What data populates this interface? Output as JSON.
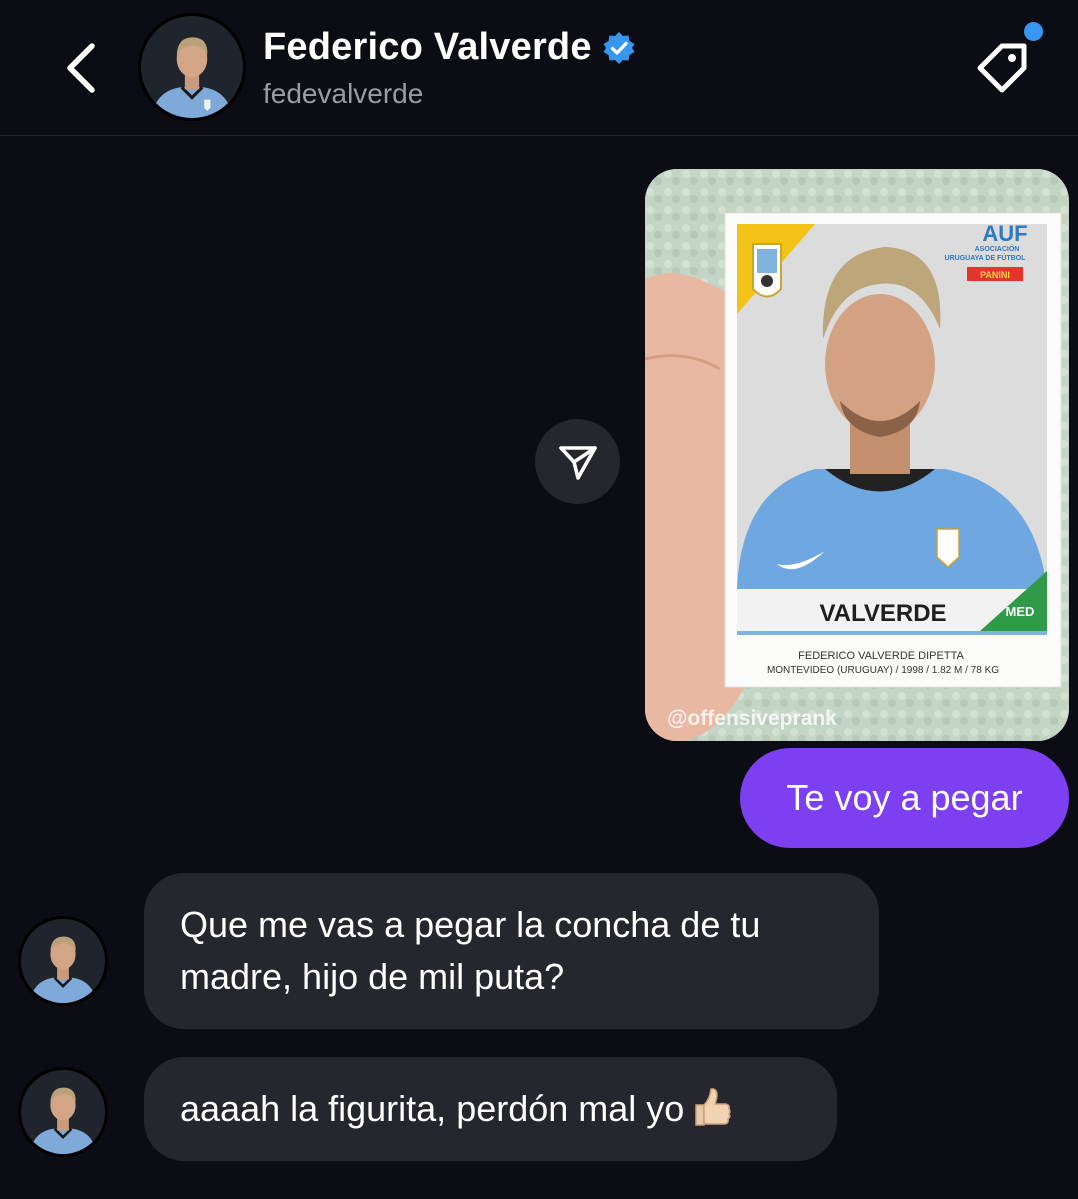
{
  "header": {
    "back_icon": "chevron-left-icon",
    "display_name": "Federico Valverde",
    "verified_icon": "verified-badge-icon",
    "username": "fedevalverde",
    "tag_icon": "tag-icon",
    "notification_dot_color": "#3897f0"
  },
  "photo_message": {
    "sticker_text": {
      "federation": "AUF",
      "federation_sub1": "ASOCIACIÓN",
      "federation_sub2": "URUGUAYA DE FÚTBOL",
      "brand": "PANINI",
      "player_surname": "VALVERDE",
      "position": "MED",
      "full_name": "FEDERICO VALVERDE DIPETTA",
      "details": "MONTEVIDEO (URUGUAY) / 1998 / 1.82 M / 78 KG"
    },
    "watermark": "@offensiveprank"
  },
  "share_icon": "paper-plane-icon",
  "messages": [
    {
      "direction": "outgoing",
      "text": "Te voy a pegar"
    },
    {
      "direction": "incoming",
      "line1": "Que me vas a pegar la concha de tu",
      "line2": "madre, hijo de mil puta?"
    },
    {
      "direction": "incoming",
      "text": "aaaah la figurita, perdón mal yo",
      "emoji_icon": "thumbs-up-icon"
    }
  ],
  "colors": {
    "background": "#0c0d14",
    "outgoing_bubble": "#7c3ff2",
    "incoming_bubble": "#26272e",
    "secondary_text": "#9a9ba3"
  }
}
